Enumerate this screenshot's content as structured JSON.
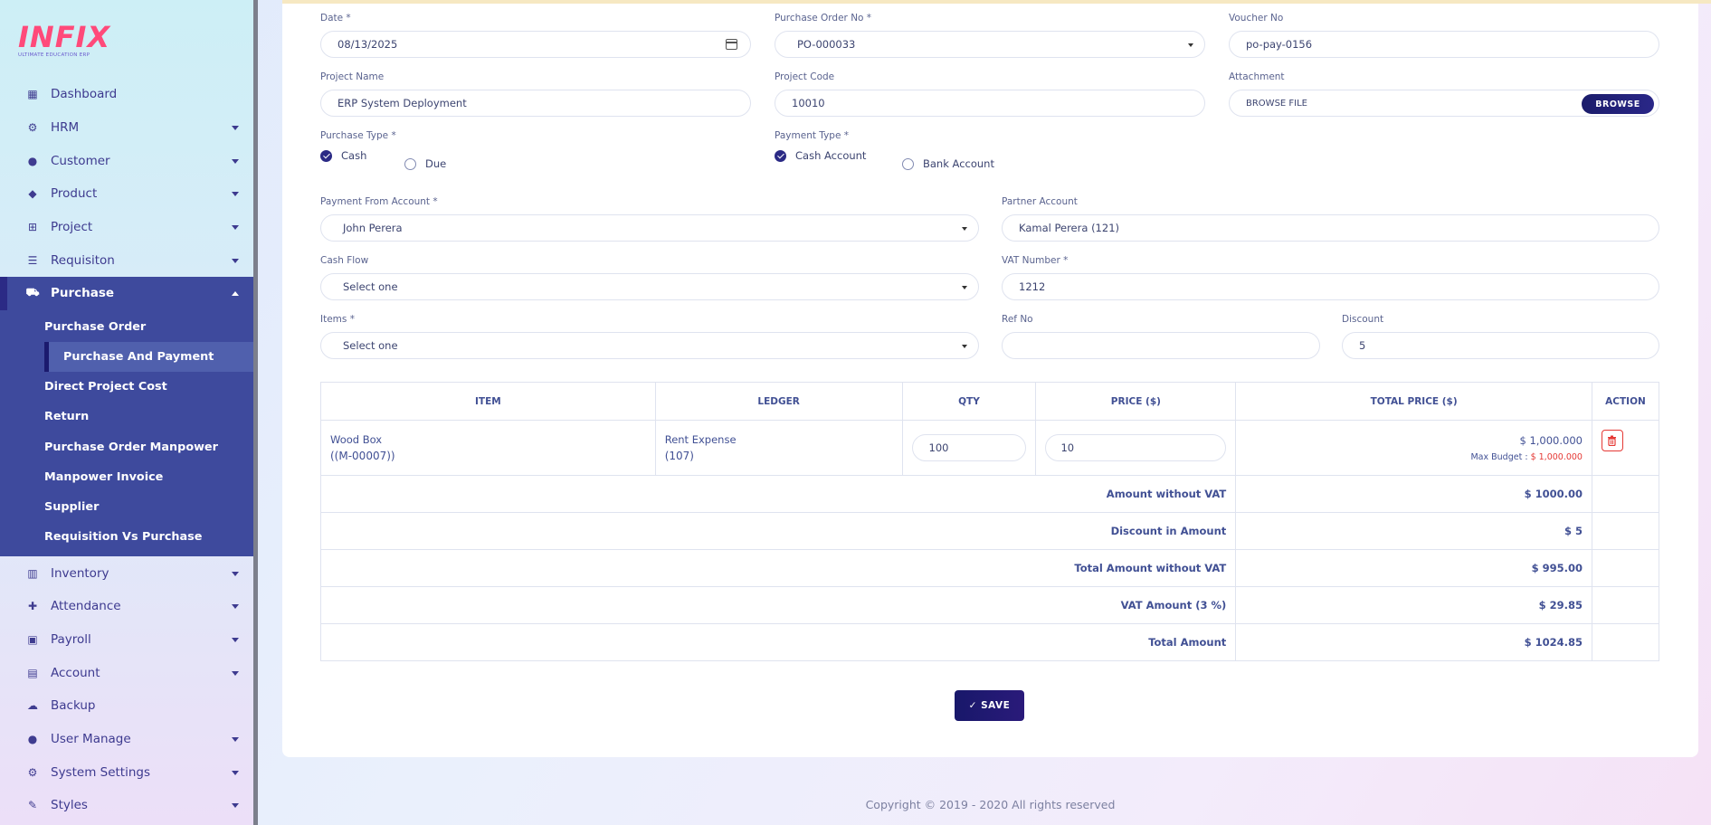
{
  "app": {
    "logo_text": "INFIX",
    "logo_tagline": "ULTIMATE EDUCATION ERP"
  },
  "sidebar": {
    "items": [
      {
        "label": "Dashboard",
        "icon": "grid-icon",
        "caret": false
      },
      {
        "label": "HRM",
        "icon": "users-cog-icon",
        "caret": true
      },
      {
        "label": "Customer",
        "icon": "user-icon",
        "caret": true
      },
      {
        "label": "Product",
        "icon": "tags-icon",
        "caret": true
      },
      {
        "label": "Project",
        "icon": "project-diagram-icon",
        "caret": true
      },
      {
        "label": "Requisiton",
        "icon": "list-icon",
        "caret": true
      },
      {
        "label": "Purchase",
        "icon": "cart-icon",
        "caret": true,
        "active": true
      },
      {
        "label": "Inventory",
        "icon": "barcode-icon",
        "caret": true
      },
      {
        "label": "Attendance",
        "icon": "user-plus-icon",
        "caret": true
      },
      {
        "label": "Payroll",
        "icon": "money-icon",
        "caret": true
      },
      {
        "label": "Account",
        "icon": "calculator-icon",
        "caret": true
      },
      {
        "label": "Backup",
        "icon": "cloud-download-icon",
        "caret": false
      },
      {
        "label": "User Manage",
        "icon": "users-icon",
        "caret": true
      },
      {
        "label": "System Settings",
        "icon": "gear-icon",
        "caret": true
      },
      {
        "label": "Styles",
        "icon": "brush-icon",
        "caret": true
      }
    ],
    "purchase_sub": [
      "Purchase Order",
      "Purchase And Payment",
      "Direct Project Cost",
      "Return",
      "Purchase Order Manpower",
      "Manpower Invoice",
      "Supplier",
      "Requisition Vs Purchase"
    ]
  },
  "form": {
    "date_label": "Date *",
    "date_value": "08/13/2025",
    "po_label": "Purchase Order No *",
    "po_value": "PO-000033",
    "voucher_label": "Voucher No",
    "voucher_value": "po-pay-0156",
    "project_name_label": "Project Name",
    "project_name_value": "ERP System Deployment",
    "project_code_label": "Project Code",
    "project_code_value": "10010",
    "attachment_label": "Attachment",
    "attachment_value": "BROWSE FILE",
    "browse_label": "BROWSE",
    "purchase_type_label": "Purchase Type *",
    "purchase_type_cash": "Cash",
    "purchase_type_due": "Due",
    "payment_type_label": "Payment Type *",
    "payment_type_cash": "Cash Account",
    "payment_type_bank": "Bank Account",
    "payment_from_label": "Payment From Account *",
    "payment_from_value": "John Perera",
    "partner_label": "Partner Account",
    "partner_value": "Kamal Perera (121)",
    "cash_flow_label": "Cash Flow",
    "cash_flow_value": "Select one",
    "vat_label": "VAT Number *",
    "vat_value": "1212",
    "items_label": "Items *",
    "items_value": "Select one",
    "ref_label": "Ref No",
    "ref_value": "",
    "discount_label": "Discount",
    "discount_value": "5"
  },
  "table": {
    "headers": {
      "item": "ITEM",
      "ledger": "LEDGER",
      "qty": "QTY",
      "price": "PRICE ($)",
      "total": "TOTAL PRICE ($)",
      "action": "ACTION"
    },
    "row": {
      "item_name": "Wood Box",
      "item_code": "((M-00007))",
      "ledger_name": "Rent Expense",
      "ledger_code": "(107)",
      "qty": "100",
      "price": "10",
      "total": "$ 1,000.000",
      "max_budget_label": "Max Budget : ",
      "max_budget_value": "$ 1,000.000"
    },
    "summary": [
      {
        "label": "Amount without VAT",
        "value": "$ 1000.00"
      },
      {
        "label": "Discount in Amount",
        "value": "$ 5"
      },
      {
        "label": "Total Amount without VAT",
        "value": "$ 995.00"
      },
      {
        "label": "VAT Amount (3 %)",
        "value": "$ 29.85"
      },
      {
        "label": "Total Amount",
        "value": "$ 1024.85"
      }
    ]
  },
  "save_label": "✓ SAVE",
  "footer": "Copyright © 2019 - 2020 All rights reserved",
  "colors": {
    "primary": "#3e4a9d",
    "danger": "#e53935",
    "text": "#415094"
  }
}
